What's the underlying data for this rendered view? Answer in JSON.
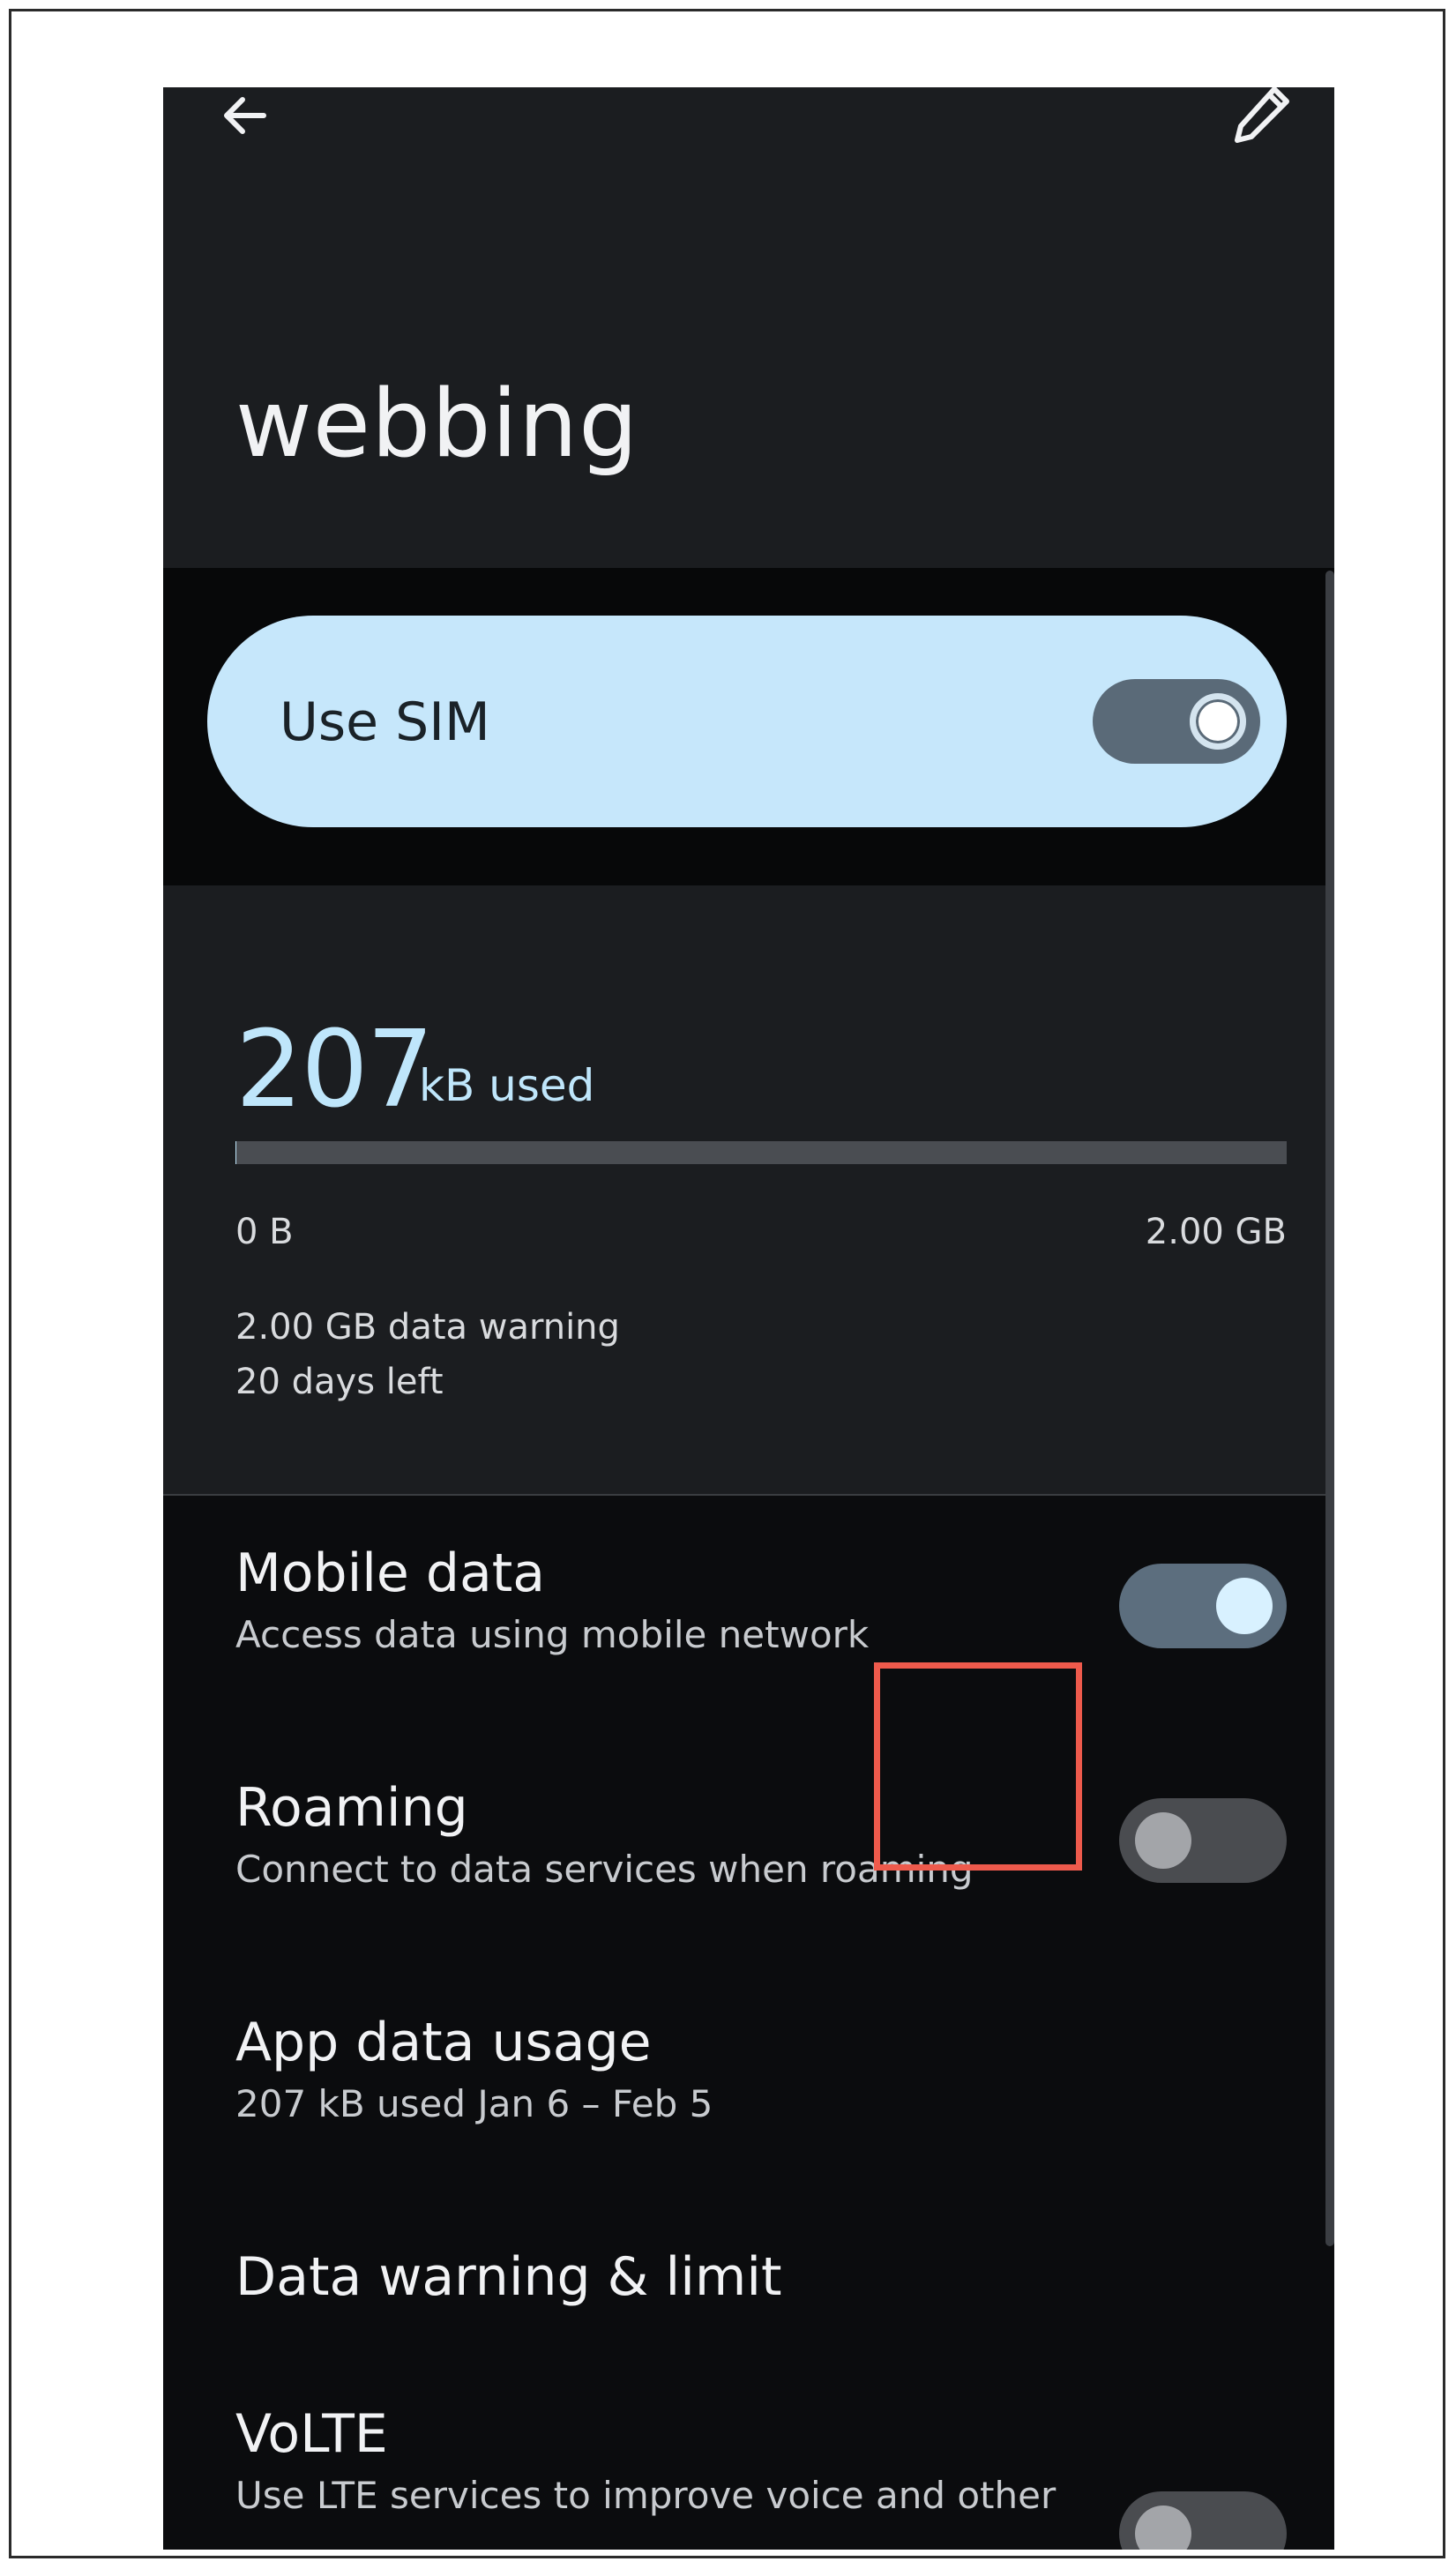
{
  "appbar": {
    "back_icon": "arrow-back-icon",
    "edit_icon": "pencil-edit-icon",
    "title": "webbing"
  },
  "sim": {
    "label": "Use SIM",
    "enabled": true
  },
  "usage": {
    "amount": "207",
    "unit_label": "kB used",
    "bar_fill_fraction": 0.0001,
    "min_label": "0 B",
    "max_label": "2.00 GB",
    "warning": "2.00 GB data warning",
    "days_left": "20 days left"
  },
  "settings": [
    {
      "title": "Mobile data",
      "subtitle": "Access data using mobile network",
      "toggle": true
    },
    {
      "title": "Roaming",
      "subtitle": "Connect to data services when roaming",
      "toggle": false,
      "highlighted": true
    },
    {
      "title": "App data usage",
      "subtitle": "207 kB used Jan 6 – Feb 5"
    },
    {
      "title": "Data warning & limit"
    },
    {
      "title": "VoLTE",
      "subtitle": "Use LTE services to improve voice and other",
      "toggle": false
    }
  ],
  "colors": {
    "accent": "#c6e7fb",
    "highlight": "#ee5a4c",
    "background": "#0b0c0e",
    "panel": "#1b1d20"
  }
}
